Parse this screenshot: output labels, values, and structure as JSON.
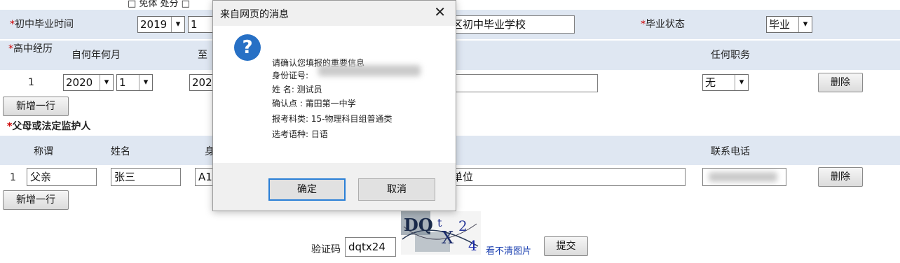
{
  "form": {
    "top_fragment": "□ 免体 处分 □",
    "junior_grad_time": {
      "label": "初中毕业时间",
      "year": "2019",
      "month": "1"
    },
    "junior_school_fragment": "区初中毕业学校",
    "grad_status": {
      "label": "毕业状态",
      "value": "毕业"
    },
    "senior_history": {
      "label": "高中经历",
      "col_from": "自何年何月",
      "col_to": "至",
      "col_position": "任何职务",
      "row_no": "1",
      "row_year": "2020",
      "row_month": "1",
      "row_to_fragment": "202",
      "row_position": "无"
    },
    "delete_label": "删除",
    "add_row_label": "新增一行",
    "guardian": {
      "label": "父母或法定监护人",
      "col_relation": "称谓",
      "col_name": "姓名",
      "col_id_fragment": "身",
      "col_phone": "联系电话",
      "row_no": "1",
      "relation": "父亲",
      "name": "张三",
      "id_fragment": "A1",
      "unit_fragment": "单位"
    },
    "captcha": {
      "label": "验证码",
      "value": "dqtx24",
      "image_text": "DQtX24",
      "refresh_link": "看不清图片",
      "submit_label": "提交"
    }
  },
  "dialog": {
    "title": "来自网页的消息",
    "close_glyph": "✕",
    "icon": "question-icon",
    "lines": [
      "请确认您填报的重要信息",
      "身份证号:",
      "姓     名: 测试员",
      "确认点  : 莆田第一中学",
      "报考科类: 15-物理科目组普通类",
      "选考语种: 日语"
    ],
    "ok_label": "确定",
    "cancel_label": "取消"
  },
  "colors": {
    "header_band": "#dfe7f2",
    "required_star": "#cc0000",
    "link": "#1a3fb0",
    "dialog_accent": "#2770c5"
  }
}
